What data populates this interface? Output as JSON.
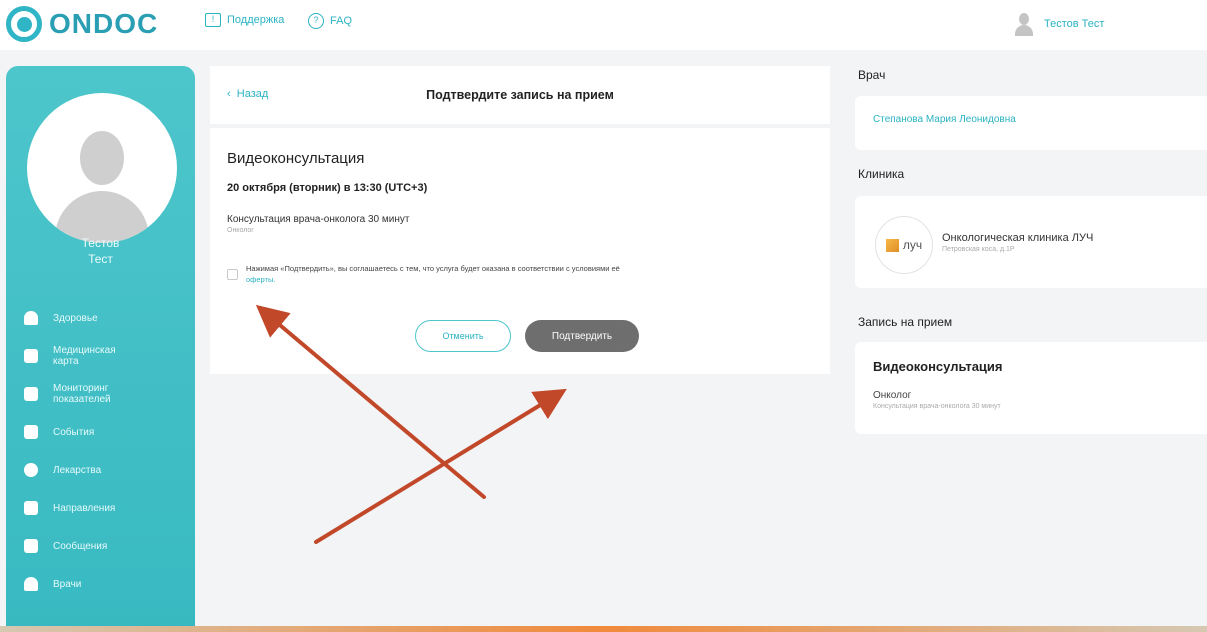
{
  "header": {
    "logo_text": "ONDOC",
    "support_label": "Поддержка",
    "faq_label": "FAQ",
    "user_name": "Тестов Тест"
  },
  "sidebar": {
    "first_name": "Тестов",
    "last_name": "Тест",
    "items": [
      {
        "label": "Здоровье",
        "icon": "heart-icon"
      },
      {
        "label": "Медицинская карта",
        "icon": "medical-card-icon"
      },
      {
        "label": "Мониторинг показателей",
        "icon": "chart-icon"
      },
      {
        "label": "События",
        "icon": "calendar-icon"
      },
      {
        "label": "Лекарства",
        "icon": "pills-icon"
      },
      {
        "label": "Направления",
        "icon": "clipboard-icon"
      },
      {
        "label": "Сообщения",
        "icon": "message-icon"
      },
      {
        "label": "Врачи",
        "icon": "doctor-icon"
      }
    ]
  },
  "main": {
    "back_label": "Назад",
    "page_title": "Подтвердите запись на прием",
    "service_type": "Видеоконсультация",
    "date_time": "20 октября (вторник) в 13:30 (UTC+3)",
    "service_name": "Консультация врача-онколога 30 минут",
    "specialty": "Онколог",
    "agreement_text": "Нажимая «Подтвердить», вы соглашаетесь с тем, что услуга будет оказана в соответствии с условиями её",
    "agreement_link": "оферты.",
    "cancel_label": "Отменить",
    "confirm_label": "Подтвердить"
  },
  "right": {
    "doctor_heading": "Врач",
    "doctor_name": "Степанова Мария Леонидовна",
    "clinic_heading": "Клиника",
    "clinic_logo_text": "луч",
    "clinic_name": "Онкологическая клиника ЛУЧ",
    "clinic_address": "Петровская коса, д.1Р",
    "appointment_heading": "Запись на прием",
    "appointment_type": "Видеоконсультация",
    "appointment_specialty": "Онколог",
    "appointment_service": "Консультация врача-онколога 30 минут"
  },
  "colors": {
    "accent": "#2bb3c2",
    "sidebar": "#40bdc4",
    "confirm_button": "#6e6e6e",
    "annotation_arrow": "#c2482a"
  }
}
